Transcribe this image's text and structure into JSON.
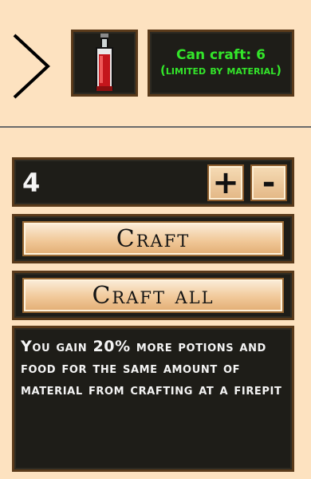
{
  "navigation": {
    "back_icon": "chevron-right-icon"
  },
  "item": {
    "icon": "red-potion-bottle-icon"
  },
  "craft_status": {
    "can_craft_line": "Can craft: 6",
    "limit_line": "(limited by material)",
    "color": "#33e52a"
  },
  "quantity": {
    "value": "4",
    "plus_label": "+",
    "minus_label": "-"
  },
  "buttons": {
    "craft_label": "Craft",
    "craft_all_label": "Craft all"
  },
  "description": {
    "text": "You gain 20% more potions and food for the same amount of material from crafting at a firepit"
  },
  "colors": {
    "background": "#fde2c0",
    "panel": "#1e1d18",
    "panel_border": "#5a3a1a",
    "text_light": "#f4f4f4"
  }
}
